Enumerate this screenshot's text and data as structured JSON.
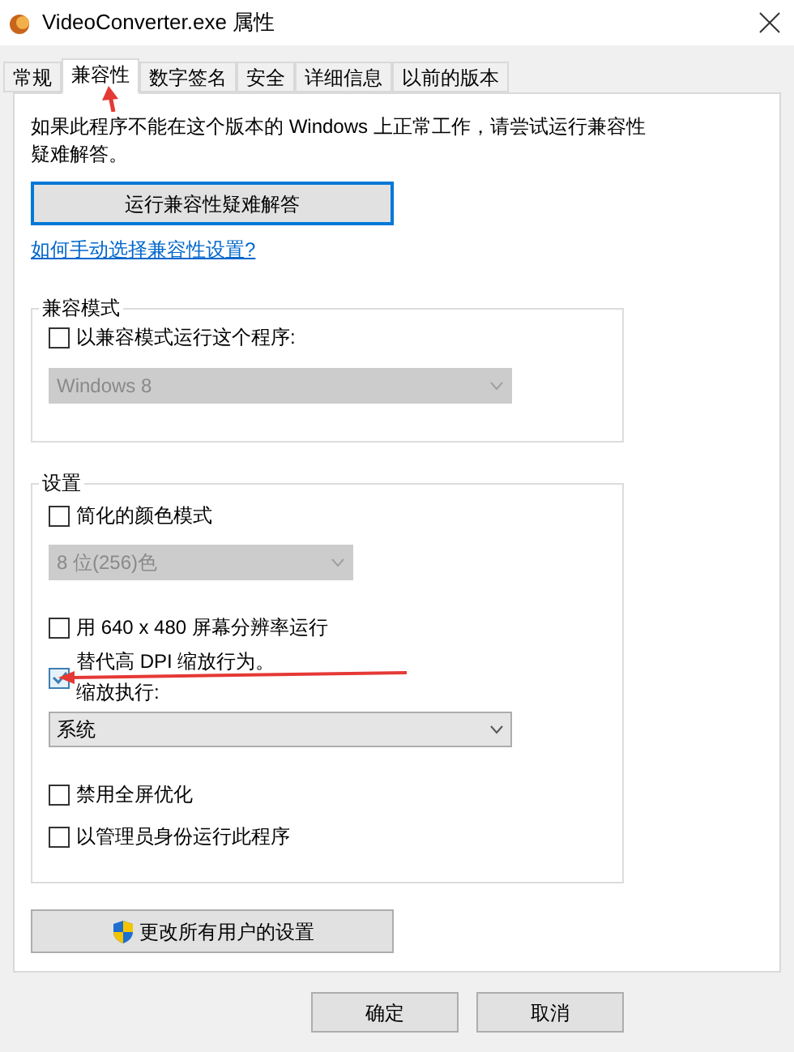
{
  "window": {
    "title": "VideoConverter.exe 属性"
  },
  "tabs": [
    {
      "label": "常规",
      "selected": false
    },
    {
      "label": "兼容性",
      "selected": true
    },
    {
      "label": "数字签名",
      "selected": false
    },
    {
      "label": "安全",
      "selected": false
    },
    {
      "label": "详细信息",
      "selected": false
    },
    {
      "label": "以前的版本",
      "selected": false
    }
  ],
  "description": "如果此程序不能在这个版本的 Windows 上正常工作，请尝试运行兼容性疑难解答。",
  "troubleshoot_button": "运行兼容性疑难解答",
  "help_link": "如何手动选择兼容性设置?",
  "compat_group": {
    "title": "兼容模式",
    "checkbox": {
      "label": "以兼容模式运行这个程序:",
      "checked": false
    },
    "dropdown": {
      "value": "Windows 8",
      "disabled": true
    }
  },
  "settings_group": {
    "title": "设置",
    "items": [
      {
        "kind": "checkbox",
        "label": "简化的颜色模式",
        "checked": false
      },
      {
        "kind": "dropdown",
        "value": "8 位(256)色",
        "disabled": true
      },
      {
        "kind": "checkbox",
        "label": "用 640 x 480 屏幕分辨率运行",
        "checked": false
      },
      {
        "kind": "checkbox",
        "label": "替代高 DPI 缩放行为。",
        "sublabel": "缩放执行:",
        "checked": true
      },
      {
        "kind": "dropdown",
        "value": "系统",
        "disabled": false
      },
      {
        "kind": "checkbox",
        "label": "禁用全屏优化",
        "checked": false
      },
      {
        "kind": "checkbox",
        "label": "以管理员身份运行此程序",
        "checked": false
      }
    ]
  },
  "all_users_button": "更改所有用户的设置",
  "buttons": [
    "确定",
    "取消"
  ]
}
